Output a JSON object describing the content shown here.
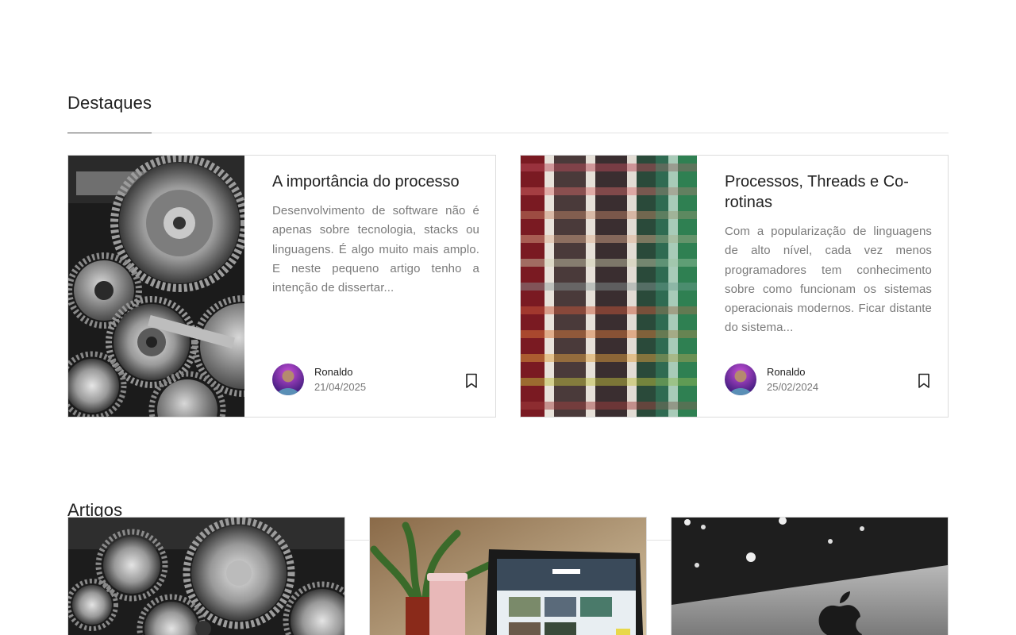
{
  "sections": {
    "featured": {
      "title": "Destaques"
    },
    "articles": {
      "title": "Artigos"
    }
  },
  "featured": [
    {
      "title": "A importância do processo",
      "excerpt": "Desenvolvimento de software não é apenas sobre tecnologia, stacks ou linguagens. É algo muito mais amplo. E neste pequeno artigo tenho a intenção de dissertar...",
      "author": "Ronaldo",
      "date": "21/04/2025",
      "image": "gears-photo",
      "bookmark_icon": "bookmark-icon"
    },
    {
      "title": "Processos, Threads e Co-rotinas",
      "excerpt": "Com a popularização de linguagens de alto nível, cada vez menos programadores tem conhecimento sobre como funcionam os sistemas operacionais modernos. Ficar distante do sistema...",
      "author": "Ronaldo",
      "date": "25/02/2024",
      "image": "thread-spools-photo",
      "bookmark_icon": "bookmark-icon"
    }
  ],
  "articles": [
    {
      "image": "gears-photo"
    },
    {
      "image": "laptop-desk-photo"
    },
    {
      "image": "apple-laptop-photo"
    }
  ]
}
